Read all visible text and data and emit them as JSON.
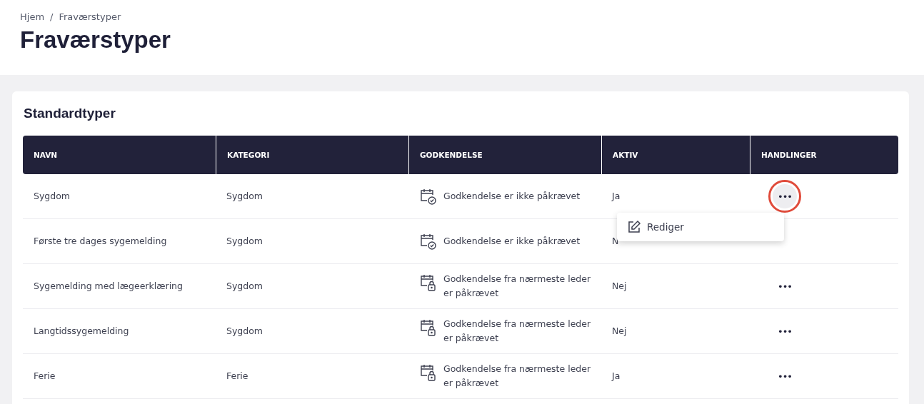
{
  "breadcrumb": [
    {
      "label": "Hjem"
    },
    {
      "label": "Fraværstyper"
    }
  ],
  "breadcrumb_separator": "/",
  "title": "Fraværstyper",
  "section": {
    "title": "Standardtyper",
    "table": {
      "columns": [
        "NAVN",
        "KATEGORI",
        "GODKENDELSE",
        "AKTIV",
        "HANDLINGER"
      ],
      "rows": [
        {
          "name": "Sygdom",
          "category": "Sygdom",
          "approval": {
            "kind": "check",
            "text": "Godkendelse er ikke påkrævet"
          },
          "active": "Ja",
          "actions": "•••",
          "menu_open": true
        },
        {
          "name": "Første tre dages sygemelding",
          "category": "Sygdom",
          "approval": {
            "kind": "check",
            "text": "Godkendelse er ikke påkrævet"
          },
          "active": "N",
          "menu_open": false
        },
        {
          "name": "Sygemelding med lægeerklæring",
          "category": "Sygdom",
          "approval": {
            "kind": "lock",
            "text": "Godkendelse fra nærmeste leder er påkrævet"
          },
          "active": "Nej",
          "actions": "•••",
          "menu_open": false
        },
        {
          "name": "Langtidssygemelding",
          "category": "Sygdom",
          "approval": {
            "kind": "lock",
            "text": "Godkendelse fra nærmeste leder er påkrævet"
          },
          "active": "Nej",
          "actions": "•••",
          "menu_open": false
        },
        {
          "name": "Ferie",
          "category": "Ferie",
          "approval": {
            "kind": "lock",
            "text": "Godkendelse fra nærmeste leder er påkrævet"
          },
          "active": "Ja",
          "actions": "•••",
          "menu_open": false
        }
      ]
    },
    "action_menu": [
      {
        "label": "Rediger"
      }
    ]
  }
}
